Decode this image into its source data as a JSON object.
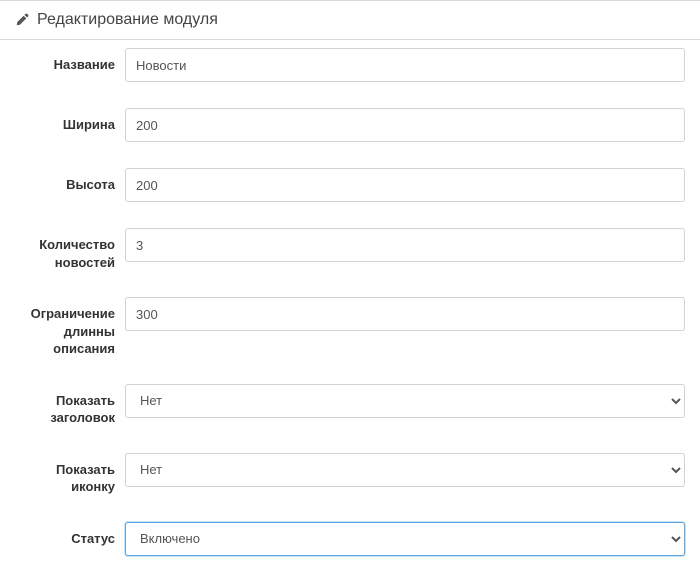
{
  "panel": {
    "title": "Редактирование модуля",
    "icon": "pencil-icon"
  },
  "form": {
    "name": {
      "label": "Название",
      "value": "Новости"
    },
    "width": {
      "label": "Ширина",
      "value": "200"
    },
    "height": {
      "label": "Высота",
      "value": "200"
    },
    "news_count": {
      "label": "Количество новостей",
      "value": "3"
    },
    "desc_limit": {
      "label": "Ограничение длинны описания",
      "value": "300"
    },
    "show_title": {
      "label": "Показать заголовок",
      "value": "Нет"
    },
    "show_icon": {
      "label": "Показать иконку",
      "value": "Нет"
    },
    "status": {
      "label": "Статус",
      "value": "Включено"
    }
  }
}
